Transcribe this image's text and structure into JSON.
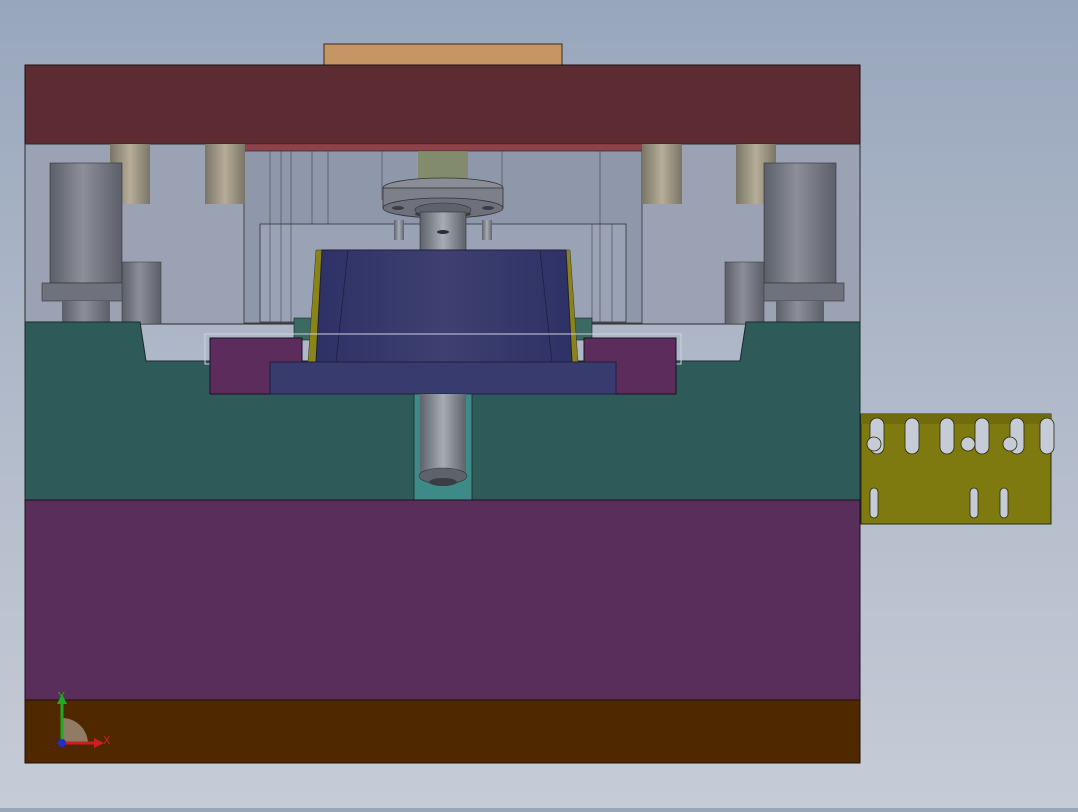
{
  "viewport": {
    "view": "cad-3d-viewport",
    "background_colors": [
      "#98a6bc",
      "#c6ccd7"
    ]
  },
  "model": {
    "colors": {
      "top_clamp_plate": "#5c2c32",
      "upper_feature_plate": "#c69563",
      "die_block": "#2e5a5a",
      "die_shoe": "#5a2e5a",
      "bottom_plate": "#4f2800",
      "punch": "#383b66",
      "pad": "#5c2c5c",
      "strip": "#7e7a10",
      "guide_post": "#72757f",
      "cavity": "#9aa2b4"
    }
  },
  "triad": {
    "x_label": "X",
    "y_label": "Y",
    "x_color": "#cc1f1f",
    "y_color": "#1faa1f",
    "z_color": "#1f2fcc"
  }
}
